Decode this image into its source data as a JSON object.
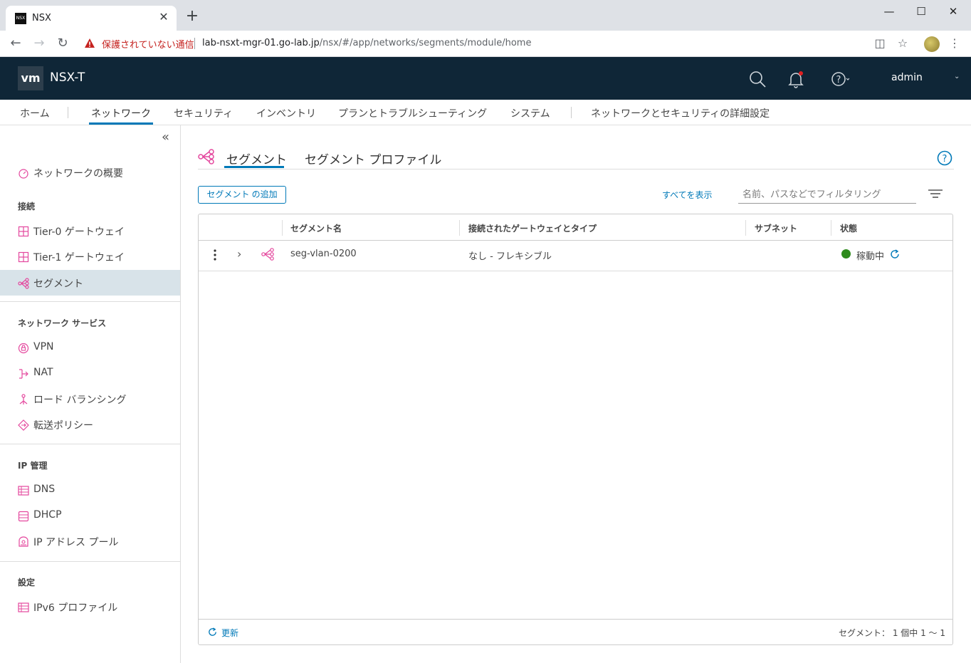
{
  "browser": {
    "tab_title": "NSX",
    "favicon_text": "NSX",
    "close_glyph": "✕",
    "newtab_glyph": "+",
    "security_label": "保護されていない通信",
    "url_host": "lab-nsxt-mgr-01.go-lab.jp",
    "url_path": "/nsx/#/app/networks/segments/module/home"
  },
  "header": {
    "logo": "vm",
    "brand": "NSX-T",
    "user": "admin",
    "bell_badge_color": "#e02020"
  },
  "topnav": {
    "items": [
      "ホーム",
      "ネットワーク",
      "セキュリティ",
      "インベントリ",
      "プランとトラブルシューティング",
      "システム",
      "ネットワークとセキュリティの詳細設定"
    ],
    "active": "ネットワーク"
  },
  "sidebar": {
    "overview": "ネットワークの概要",
    "section_connect": "接続",
    "tier0": "Tier-0 ゲートウェイ",
    "tier1": "Tier-1 ゲートウェイ",
    "segments": "セグメント",
    "section_services": "ネットワーク サービス",
    "vpn": "VPN",
    "nat": "NAT",
    "lb": "ロード バランシング",
    "forwarding": "転送ポリシー",
    "section_ip": "IP 管理",
    "dns": "DNS",
    "dhcp": "DHCP",
    "ippool": "IP アドレス プール",
    "section_settings": "設定",
    "ipv6": "IPv6 プロファイル"
  },
  "main": {
    "tab_segments": "セグメント",
    "tab_profiles": "セグメント プロファイル",
    "add_button": "セグメント の追加",
    "show_all": "すべてを表示",
    "filter_placeholder": "名前、パスなどでフィルタリング",
    "accent_color": "#0079b8",
    "icon_color": "#e4489e"
  },
  "grid": {
    "columns": [
      "セグメント名",
      "接続されたゲートウェイとタイプ",
      "サブネット",
      "状態"
    ],
    "rows": [
      {
        "name": "seg-vlan-0200",
        "gateway": "なし - フレキシブル",
        "subnet": "",
        "status": "稼動中",
        "status_color": "#2e8b1c"
      }
    ],
    "refresh_label": "更新",
    "count_text": "セグメント： 1 個中 1 ～ 1"
  }
}
